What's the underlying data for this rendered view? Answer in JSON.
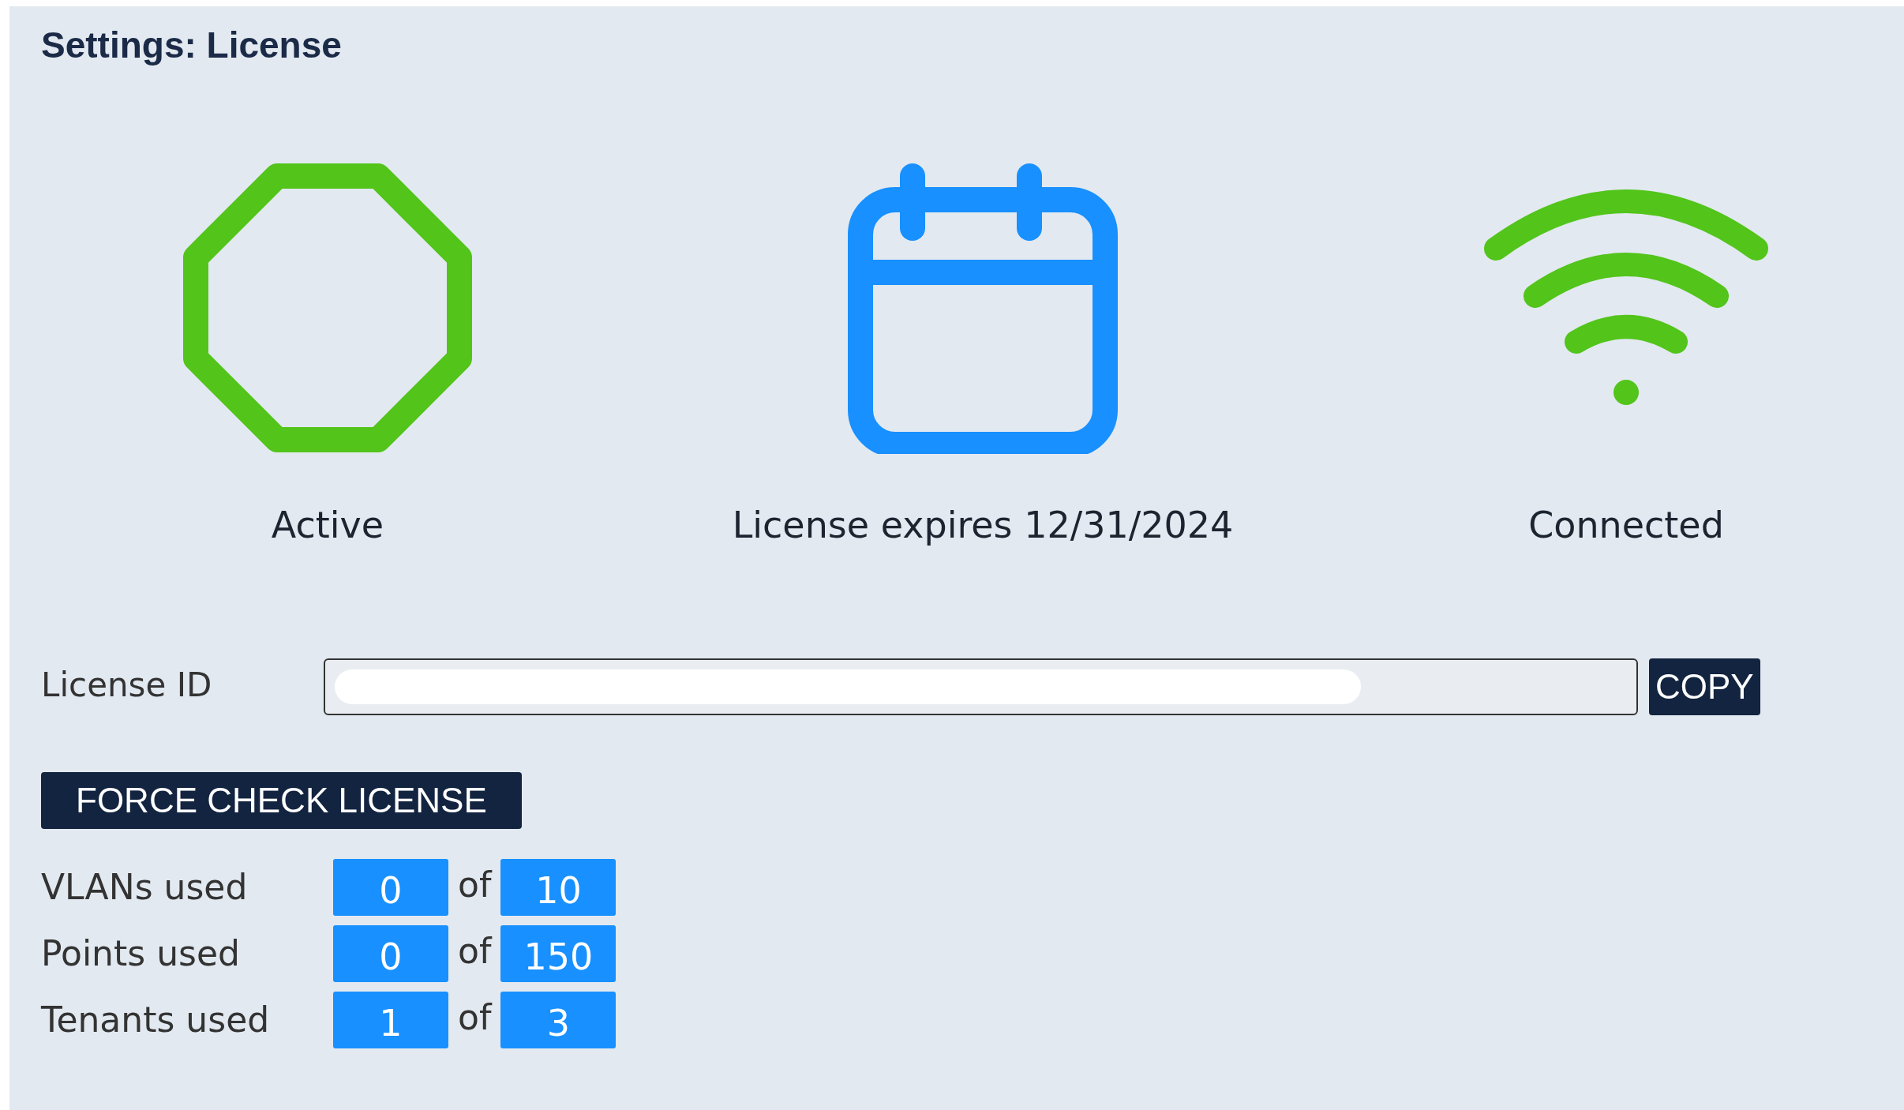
{
  "title": "Settings: License",
  "status": [
    {
      "kind": "octagon",
      "label": "Active",
      "color": "#52c41a"
    },
    {
      "kind": "calendar",
      "label": "License expires 12/31/2024",
      "color": "#1890ff"
    },
    {
      "kind": "wifi",
      "label": "Connected",
      "color": "#52c41a"
    }
  ],
  "license_id": {
    "label": "License ID",
    "redacted": true,
    "button": "COPY"
  },
  "force_button": "FORCE CHECK LICENSE",
  "usage": [
    {
      "label": "VLANs used",
      "used": "0",
      "of": "of",
      "limit": "10"
    },
    {
      "label": "Points used",
      "used": "0",
      "of": "of",
      "limit": "150"
    },
    {
      "label": "Tenants used",
      "used": "1",
      "of": "of",
      "limit": "3"
    }
  ]
}
